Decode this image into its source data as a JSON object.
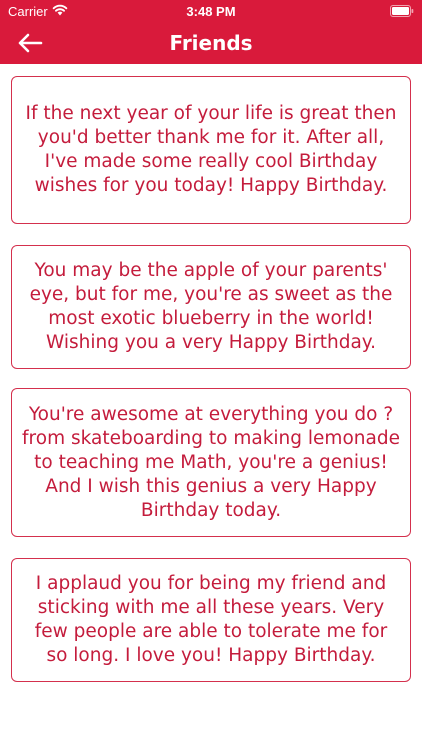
{
  "status_bar": {
    "carrier": "Carrier",
    "time": "3:48 PM",
    "wifi_icon": "wifi-icon",
    "battery_icon": "battery-icon"
  },
  "nav": {
    "title": "Friends",
    "back_icon": "arrow-left-icon"
  },
  "colors": {
    "accent": "#d91a3b",
    "card_text": "#c41c3c",
    "card_border": "#d4304d"
  },
  "wishes": [
    "If the next year of your life is great then you'd better thank me for it. After all, I've made some really cool Birthday wishes for you today! Happy Birthday.",
    "You may be the apple of your parents' eye, but for me, you're as sweet as the most exotic blueberry in the world! Wishing you a very Happy Birthday.",
    "You're awesome at everything you do ? from skateboarding to making lemonade to teaching me Math, you're a genius! And I wish this genius a very Happy Birthday today.",
    "I applaud you for being my friend and sticking with me all these years. Very few people are able to tolerate me for so long. I love you! Happy Birthday."
  ]
}
